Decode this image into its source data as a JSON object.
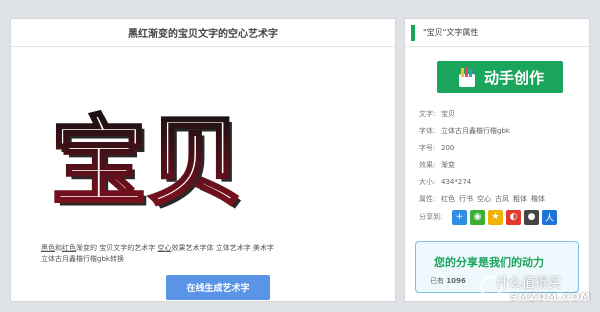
{
  "left_panel": {
    "title": "黑红渐变的宝贝文字的空心艺术字",
    "art_text": "宝贝",
    "desc_part1": "黑色",
    "desc_part2": "和",
    "desc_part3": "红色",
    "desc_part4": "渐变的 宝贝文字的艺术字",
    "desc_part5": "空心",
    "desc_part6": "效果艺术字体 立体艺术字 美术字",
    "desc_line2": "立体古月鑫楷行楷gbk转换",
    "generate_button": "在线生成艺术字"
  },
  "right_panel": {
    "title": "\"宝贝\"文字属性",
    "create_button": "动手创作",
    "props": [
      {
        "key": "文字:",
        "value": "宝贝"
      },
      {
        "key": "字体:",
        "value": "立体古月鑫楷行楷gbk"
      },
      {
        "key": "字号:",
        "value": "200"
      },
      {
        "key": "效果:",
        "value": "渐变"
      },
      {
        "key": "大小:",
        "value": "434*274"
      }
    ],
    "attr_key": "属性:",
    "attr_tags": [
      "红色",
      "行书",
      "空心",
      "古风",
      "粗体",
      "楷体"
    ],
    "share_label": "分享到:",
    "callout_title": "您的分享是我们的动力",
    "callout_count_prefix": "已有",
    "callout_count": "1096"
  },
  "watermark": {
    "line1": "什么值得买",
    "line2": "SMZDM.COM"
  },
  "colors": {
    "accent_green": "#1aa55c",
    "button_blue": "#5a94e6",
    "art_red": "#8b1020",
    "art_black": "#111111"
  }
}
